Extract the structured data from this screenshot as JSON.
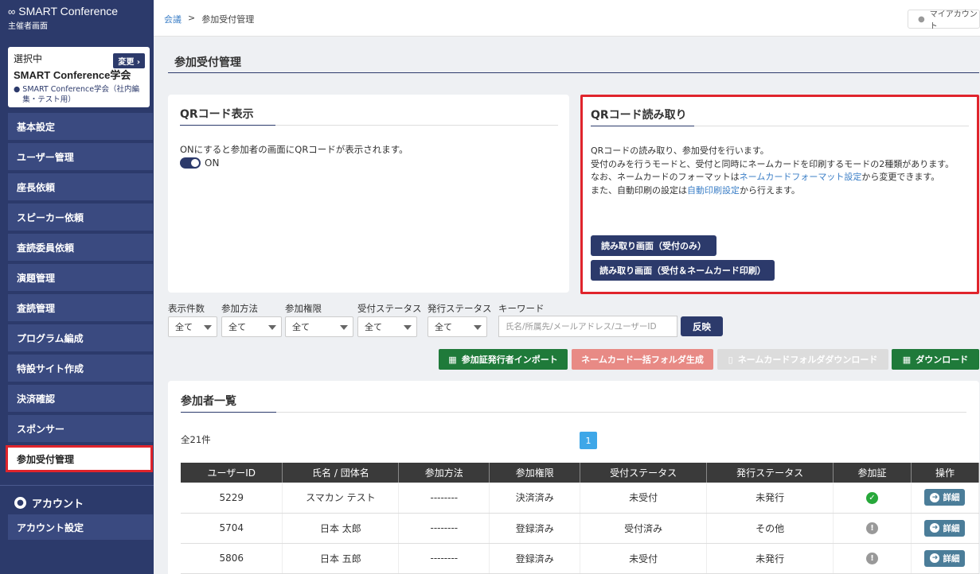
{
  "brand": {
    "name": "SMART Conference",
    "sub": "主催者画面"
  },
  "selected": {
    "label": "選択中",
    "change": "変更",
    "name": "SMART Conference学会",
    "org": "SMART Conference学会（社内編集・テスト用）"
  },
  "nav": [
    "基本設定",
    "ユーザー管理",
    "座長依頼",
    "スピーカー依頼",
    "査読委員依頼",
    "演題管理",
    "査読管理",
    "プログラム編成",
    "特設サイト作成",
    "決済確認",
    "スポンサー",
    "参加受付管理"
  ],
  "account": {
    "heading": "アカウント",
    "settings": "アカウント設定"
  },
  "breadcrumb": {
    "root": "会議",
    "sep": ">",
    "current": "参加受付管理"
  },
  "my_account": "マイアカウント",
  "page_title": "参加受付管理",
  "qr_display": {
    "title": "QRコード表示",
    "desc": "ONにすると参加者の画面にQRコードが表示されます。",
    "toggle_label": "ON"
  },
  "qr_read": {
    "title": "QRコード読み取り",
    "line1": "QRコードの読み取り、参加受付を行います。",
    "line2": "受付のみを行うモードと、受付と同時にネームカードを印刷するモードの2種類があります。",
    "line3_pre": "なお、ネームカードのフォーマットは",
    "line3_link": "ネームカードフォーマット設定",
    "line3_post": "から変更できます。",
    "line4_pre": "また、自動印刷の設定は",
    "line4_link": "自動印刷設定",
    "line4_post": "から行えます。",
    "btn1": "読み取り画面（受付のみ）",
    "btn2": "読み取り画面（受付＆ネームカード印刷）"
  },
  "filters": {
    "labels": [
      "表示件数",
      "参加方法",
      "参加権限",
      "受付ステータス",
      "発行ステータス",
      "キーワード"
    ],
    "value": "全て",
    "keyword_placeholder": "氏名/所属先/メールアドレス/ユーザーID",
    "apply": "反映"
  },
  "actions": {
    "import": "参加証発行者インポート",
    "bulk_folder": "ネームカード一括フォルダ生成",
    "folder_download": "ネームカードフォルダダウンロード",
    "download": "ダウンロード"
  },
  "list": {
    "title": "参加者一覧",
    "count": "全21件",
    "page": "1",
    "columns": [
      "ユーザーID",
      "氏名 / 団体名",
      "参加方法",
      "参加権限",
      "受付ステータス",
      "発行ステータス",
      "参加証",
      "操作"
    ],
    "rows": [
      {
        "id": "5229",
        "name": "スマカン テスト",
        "method": "--------",
        "perm": "決済済み",
        "reception": "未受付",
        "issue": "未発行",
        "badge": "ok"
      },
      {
        "id": "5704",
        "name": "日本 太郎",
        "method": "--------",
        "perm": "登録済み",
        "reception": "受付済み",
        "issue": "その他",
        "badge": "warn"
      },
      {
        "id": "5806",
        "name": "日本 五郎",
        "method": "--------",
        "perm": "登録済み",
        "reception": "未受付",
        "issue": "未発行",
        "badge": "warn"
      }
    ],
    "detail": "詳細"
  },
  "colors": {
    "sidebar": "#2c3a6b",
    "highlight": "#e0242c",
    "green": "#1f7a3a",
    "salmon": "#e88a85"
  }
}
